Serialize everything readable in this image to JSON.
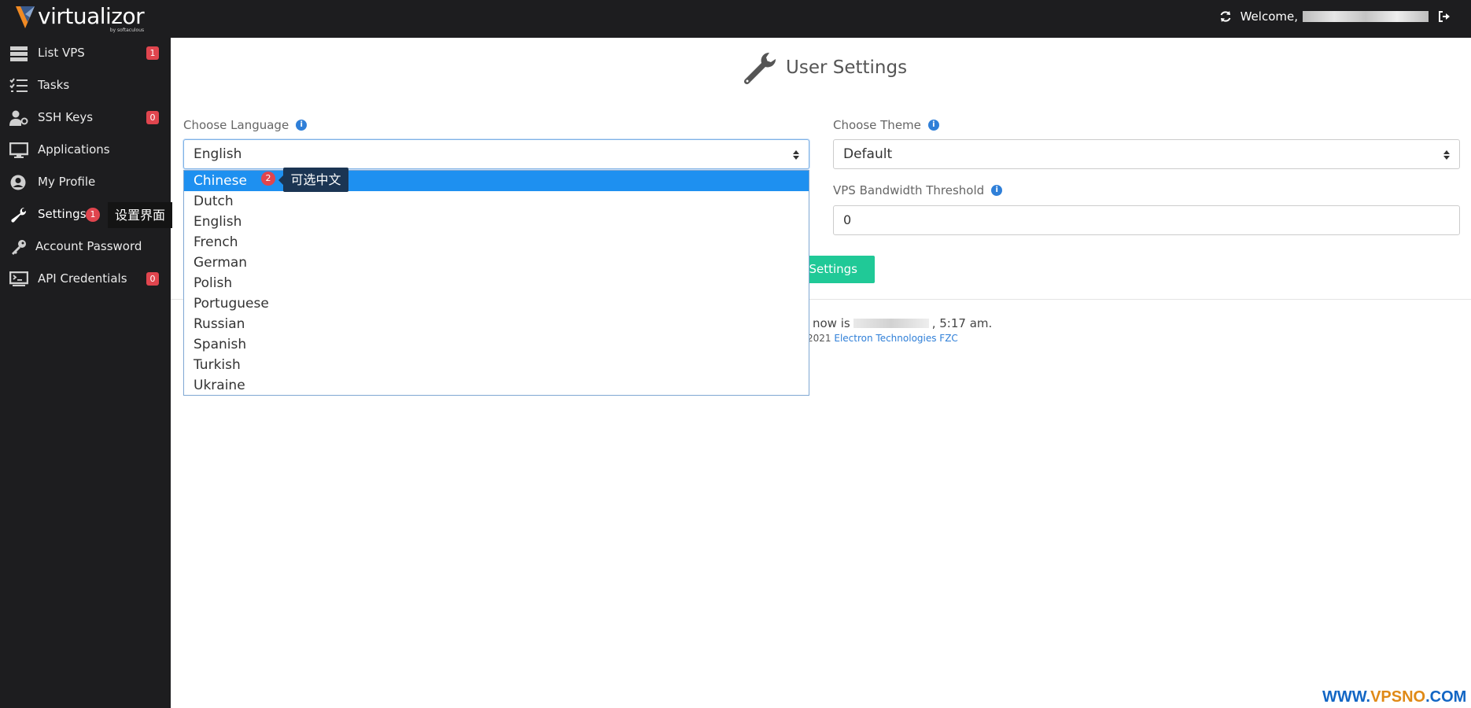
{
  "app": {
    "logo_text": "virtualizor",
    "logo_subtext": "by softaculous"
  },
  "topbar": {
    "welcome": "Welcome,",
    "icons": [
      "refresh-icon",
      "logout-icon"
    ]
  },
  "sidebar": {
    "items": [
      {
        "label": "List VPS",
        "icon": "server-list-icon",
        "badge": "1"
      },
      {
        "label": "Tasks",
        "icon": "tasks-icon",
        "badge": ""
      },
      {
        "label": "SSH Keys",
        "icon": "user-key-icon",
        "badge": "0"
      },
      {
        "label": "Applications",
        "icon": "monitor-icon",
        "badge": ""
      },
      {
        "label": "My Profile",
        "icon": "user-circle-icon",
        "badge": ""
      },
      {
        "label": "Settings",
        "icon": "wrench-icon",
        "badge": ""
      },
      {
        "label": "Account Password",
        "icon": "key-icon",
        "badge": ""
      },
      {
        "label": "API Credentials",
        "icon": "terminal-icon",
        "badge": "0"
      }
    ],
    "settings_annotation_number": "1",
    "settings_tooltip": "设置界面"
  },
  "main": {
    "title": "User Settings",
    "choose_language_label": "Choose Language",
    "language_value": "English",
    "choose_theme_label": "Choose Theme",
    "theme_value": "Default",
    "bandwidth_label": "VPS Bandwidth Threshold",
    "bandwidth_value": "0",
    "save_button_label": "Settings",
    "footer_time_prefix": "now is",
    "footer_time_suffix": ", 5:17 am.",
    "footer_copyright_prefix": "2021",
    "footer_company": "Electron Technologies FZC"
  },
  "language_dropdown": {
    "options": [
      "Chinese",
      "Dutch",
      "English",
      "French",
      "German",
      "Polish",
      "Portuguese",
      "Russian",
      "Spanish",
      "Turkish",
      "Ukraine"
    ],
    "highlighted": "Chinese",
    "annotation_number": "2",
    "annotation_tooltip": "可选中文"
  },
  "watermark": {
    "part1": "WWW.",
    "part2": "VPSNO",
    "part3": ".COM"
  },
  "colors": {
    "sidebar_bg": "#1d1d1f",
    "accent_green": "#20c997",
    "highlight_blue": "#1e90f0",
    "badge_red": "#e0454e"
  }
}
